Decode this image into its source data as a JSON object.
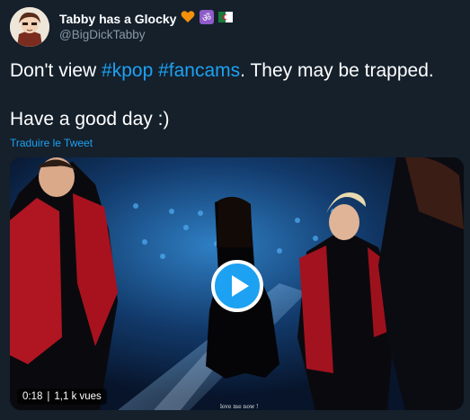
{
  "author": {
    "display_name": "Tabby has a Glocky",
    "handle": "@BigDickTabby",
    "badges": [
      "orange-heart-icon",
      "om-symbol-icon",
      "flag-icon"
    ]
  },
  "tweet": {
    "line1_prefix": "Don't view ",
    "hashtag1": "#kpop",
    "hashtag2": "#fancams",
    "line1_suffix": ". They may be trapped.",
    "line2": "Have a good day :)",
    "translate_link": "Traduire le Tweet"
  },
  "video": {
    "duration": "0:18",
    "views": "1,1 k vues",
    "caption": "love me now !"
  },
  "colors": {
    "background": "#15202b",
    "accent": "#1da1f2",
    "secondary_text": "#8899a6"
  }
}
